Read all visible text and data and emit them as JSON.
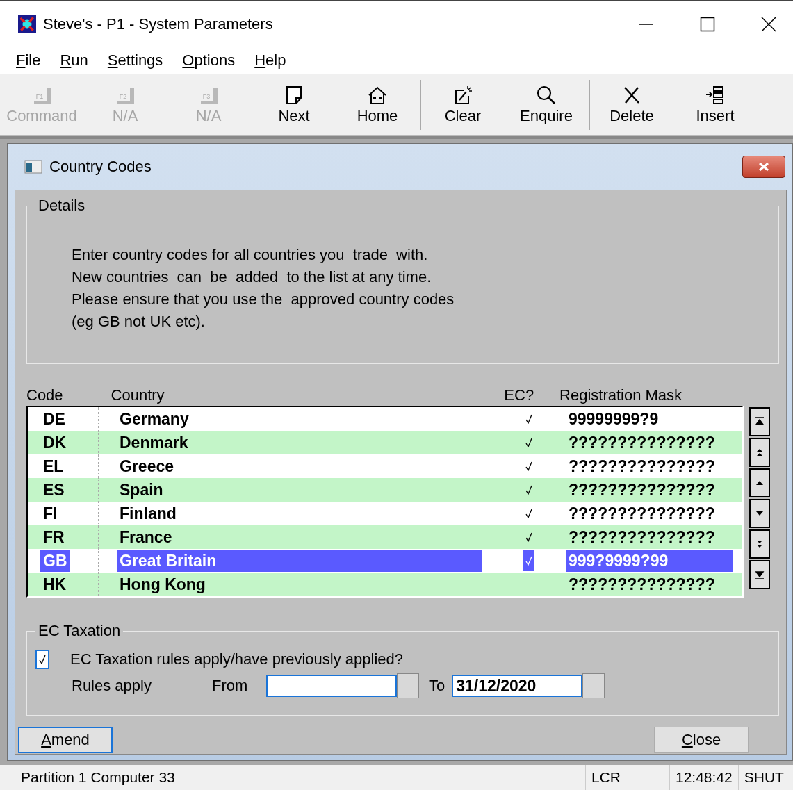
{
  "window": {
    "title": "Steve's - P1 - System Parameters"
  },
  "menu": [
    {
      "label": "File"
    },
    {
      "label": "Run"
    },
    {
      "label": "Settings"
    },
    {
      "label": "Options"
    },
    {
      "label": "Help"
    }
  ],
  "toolbar": [
    {
      "kind": "fkey",
      "key": "F1",
      "label": "Command",
      "disabled": true
    },
    {
      "kind": "fkey",
      "key": "F2",
      "label": "N/A",
      "disabled": true
    },
    {
      "kind": "fkey",
      "key": "F3",
      "label": "N/A",
      "disabled": true
    },
    {
      "kind": "next",
      "label": "Next",
      "disabled": false
    },
    {
      "kind": "home",
      "label": "Home",
      "disabled": false
    },
    {
      "kind": "clear",
      "label": "Clear",
      "disabled": false
    },
    {
      "kind": "enquire",
      "label": "Enquire",
      "disabled": false
    },
    {
      "kind": "delete",
      "label": "Delete",
      "disabled": false
    },
    {
      "kind": "insert",
      "label": "Insert",
      "disabled": false
    }
  ],
  "dialog": {
    "title": "Country Codes",
    "details": {
      "legend": "Details",
      "lines": [
        "Enter country codes for all countries you  trade  with.",
        "New countries  can  be  added  to the list at any time.",
        "Please ensure that you use the  approved country codes",
        "(eg GB not UK etc)."
      ]
    },
    "table": {
      "columns": [
        "Code",
        "Country",
        "EC?",
        "Registration Mask"
      ],
      "rows": [
        {
          "code": "DE",
          "country": "Germany",
          "ec": true,
          "mask": "99999999?9",
          "selected": false
        },
        {
          "code": "DK",
          "country": "Denmark",
          "ec": true,
          "mask": "???????????????",
          "selected": false
        },
        {
          "code": "EL",
          "country": "Greece",
          "ec": true,
          "mask": "???????????????",
          "selected": false
        },
        {
          "code": "ES",
          "country": "Spain",
          "ec": true,
          "mask": "???????????????",
          "selected": false
        },
        {
          "code": "FI",
          "country": "Finland",
          "ec": true,
          "mask": "???????????????",
          "selected": false
        },
        {
          "code": "FR",
          "country": "France",
          "ec": true,
          "mask": "???????????????",
          "selected": false
        },
        {
          "code": "GB",
          "country": "Great Britain",
          "ec": true,
          "mask": "999?9999?99",
          "selected": true
        },
        {
          "code": "HK",
          "country": "Hong Kong",
          "ec": false,
          "mask": "???????????????",
          "selected": false
        }
      ]
    },
    "ec_taxation": {
      "legend": "EC Taxation",
      "checkbox_label": "EC Taxation rules apply/have previously applied?",
      "checked": true,
      "rules_label": "Rules apply",
      "from_label": "From",
      "to_label": "To",
      "to_value": "31/12/2020"
    },
    "buttons": [
      {
        "label": "Amend",
        "focused": true
      },
      {
        "label": "Close",
        "focused": false
      }
    ]
  },
  "status_bar": [
    "Partition 1 Computer 33",
    "LCR",
    "12:48:42",
    "SHUT"
  ]
}
